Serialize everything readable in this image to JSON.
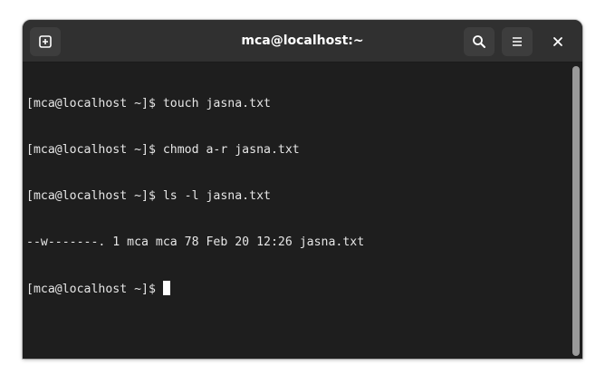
{
  "window": {
    "title": "mca@localhost:~"
  },
  "headerbar": {
    "new_tab_icon": "new-tab-icon",
    "search_icon": "search-icon",
    "menu_icon": "hamburger-menu-icon",
    "close_icon": "close-icon"
  },
  "terminal": {
    "prompt": "[mca@localhost ~]$ ",
    "lines": [
      "[mca@localhost ~]$ touch jasna.txt",
      "[mca@localhost ~]$ chmod a-r jasna.txt",
      "[mca@localhost ~]$ ls -l jasna.txt",
      "--w-------. 1 mca mca 78 Feb 20 12:26 jasna.txt"
    ]
  },
  "colors": {
    "headerbar": "#303030",
    "terminal_bg": "#1e1e1e",
    "terminal_fg": "#e6e6e6",
    "cursor": "#ffffff"
  }
}
